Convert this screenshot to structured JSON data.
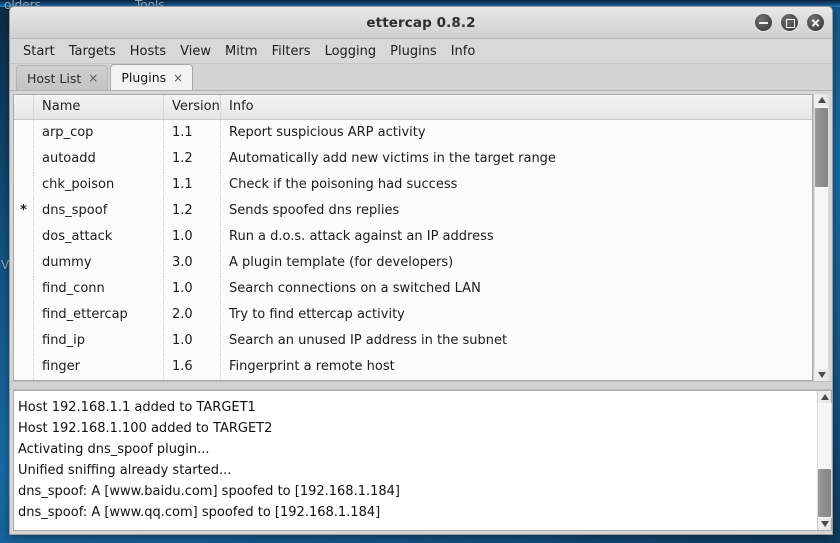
{
  "desktop": {
    "labels": [
      "olders",
      "Tools",
      "V"
    ]
  },
  "window": {
    "title": "ettercap 0.8.2",
    "controls": {
      "minimize": "minimize-button",
      "maximize": "maximize-button",
      "close": "close-button"
    }
  },
  "menubar": {
    "items": [
      {
        "label": "Start"
      },
      {
        "label": "Targets"
      },
      {
        "label": "Hosts"
      },
      {
        "label": "View"
      },
      {
        "label": "Mitm"
      },
      {
        "label": "Filters"
      },
      {
        "label": "Logging"
      },
      {
        "label": "Plugins"
      },
      {
        "label": "Info"
      }
    ]
  },
  "tabs": {
    "close_glyph": "×",
    "items": [
      {
        "label": "Host List",
        "active": false
      },
      {
        "label": "Plugins",
        "active": true
      }
    ]
  },
  "plugin_table": {
    "columns": {
      "mark": "",
      "name": "Name",
      "version": "Version",
      "info": "Info"
    },
    "rows": [
      {
        "mark": "",
        "name": "arp_cop",
        "version": "1.1",
        "info": "Report suspicious ARP activity"
      },
      {
        "mark": "",
        "name": "autoadd",
        "version": "1.2",
        "info": "Automatically add new victims in the target range"
      },
      {
        "mark": "",
        "name": "chk_poison",
        "version": "1.1",
        "info": "Check if the poisoning had success"
      },
      {
        "mark": "*",
        "name": "dns_spoof",
        "version": "1.2",
        "info": "Sends spoofed dns replies"
      },
      {
        "mark": "",
        "name": "dos_attack",
        "version": "1.0",
        "info": "Run a d.o.s. attack against an IP address"
      },
      {
        "mark": "",
        "name": "dummy",
        "version": "3.0",
        "info": "A plugin template (for developers)"
      },
      {
        "mark": "",
        "name": "find_conn",
        "version": "1.0",
        "info": "Search connections on a switched LAN"
      },
      {
        "mark": "",
        "name": "find_ettercap",
        "version": "2.0",
        "info": "Try to find ettercap activity"
      },
      {
        "mark": "",
        "name": "find_ip",
        "version": "1.0",
        "info": "Search an unused IP address in the subnet"
      },
      {
        "mark": "",
        "name": "finger",
        "version": "1.6",
        "info": "Fingerprint a remote host"
      }
    ]
  },
  "log": {
    "lines": [
      "Host 192.168.1.1 added to TARGET1",
      "Host 192.168.1.100 added to TARGET2",
      "Activating dns_spoof plugin...",
      "Unified sniffing already started...",
      "dns_spoof: A [www.baidu.com] spoofed to [192.168.1.184]",
      "dns_spoof: A [www.qq.com] spoofed to [192.168.1.184]"
    ]
  },
  "colors": {
    "desktop": "#13517f",
    "window_chrome": "#d6d6d6",
    "table_bg": "#fbfbfb",
    "log_bg": "#ffffff",
    "scrollbar_thumb": "#8d8d8d"
  }
}
